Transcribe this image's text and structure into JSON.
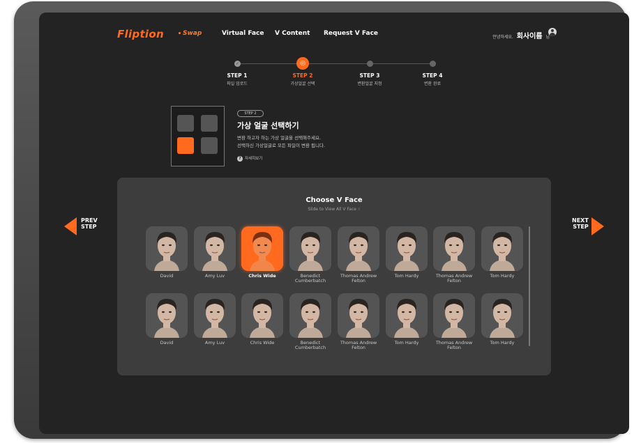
{
  "brand": {
    "logo": "Fliption",
    "accent": "#ff6a1f"
  },
  "nav": [
    {
      "label": "Swap",
      "active": true
    },
    {
      "label": "Virtual Face"
    },
    {
      "label": "V Content"
    },
    {
      "label": "Request V Face"
    }
  ],
  "user": {
    "greeting": "안녕하세요.",
    "name": "회사이름",
    "suffix": "님"
  },
  "steps": [
    {
      "title": "STEP 1",
      "sub": "파일 업로드",
      "state": "done"
    },
    {
      "title": "STEP 2",
      "sub": "가상얼굴 선택",
      "state": "current"
    },
    {
      "title": "STEP 3",
      "sub": "변환얼굴 지정",
      "state": "todo"
    },
    {
      "title": "STEP 4",
      "sub": "변환 완료",
      "state": "todo"
    }
  ],
  "step_info": {
    "badge": "STEP 2",
    "title": "가상 얼굴 선택하기",
    "desc1": "변환 하고자 하는 가상 얼굴을 선택해주세요.",
    "desc2": "선택하신 가상얼굴로 모든 파일이 변환 됩니다.",
    "help": "자세히보기"
  },
  "panel": {
    "title": "Choose V Face",
    "sub": "Slide to View All V Face",
    "rows": [
      [
        {
          "name": "David"
        },
        {
          "name": "Amy Luv"
        },
        {
          "name": "Chris Wide",
          "selected": true
        },
        {
          "name": "Benedict Cumberbatch"
        },
        {
          "name": "Thomas Andrew Felton"
        },
        {
          "name": "Tom Hardy"
        },
        {
          "name": "Thomas Andrew Felton"
        },
        {
          "name": "Tom Hardy"
        }
      ],
      [
        {
          "name": "David"
        },
        {
          "name": "Amy Luv"
        },
        {
          "name": "Chris Wide"
        },
        {
          "name": "Benedict Cumberbatch"
        },
        {
          "name": "Thomas Andrew Felton"
        },
        {
          "name": "Tom Hardy"
        },
        {
          "name": "Thomas Andrew Felton"
        },
        {
          "name": "Tom Hardy"
        }
      ]
    ]
  },
  "prev": {
    "line1": "PREV",
    "line2": "STEP"
  },
  "next": {
    "line1": "NEXT",
    "line2": "STEP"
  }
}
